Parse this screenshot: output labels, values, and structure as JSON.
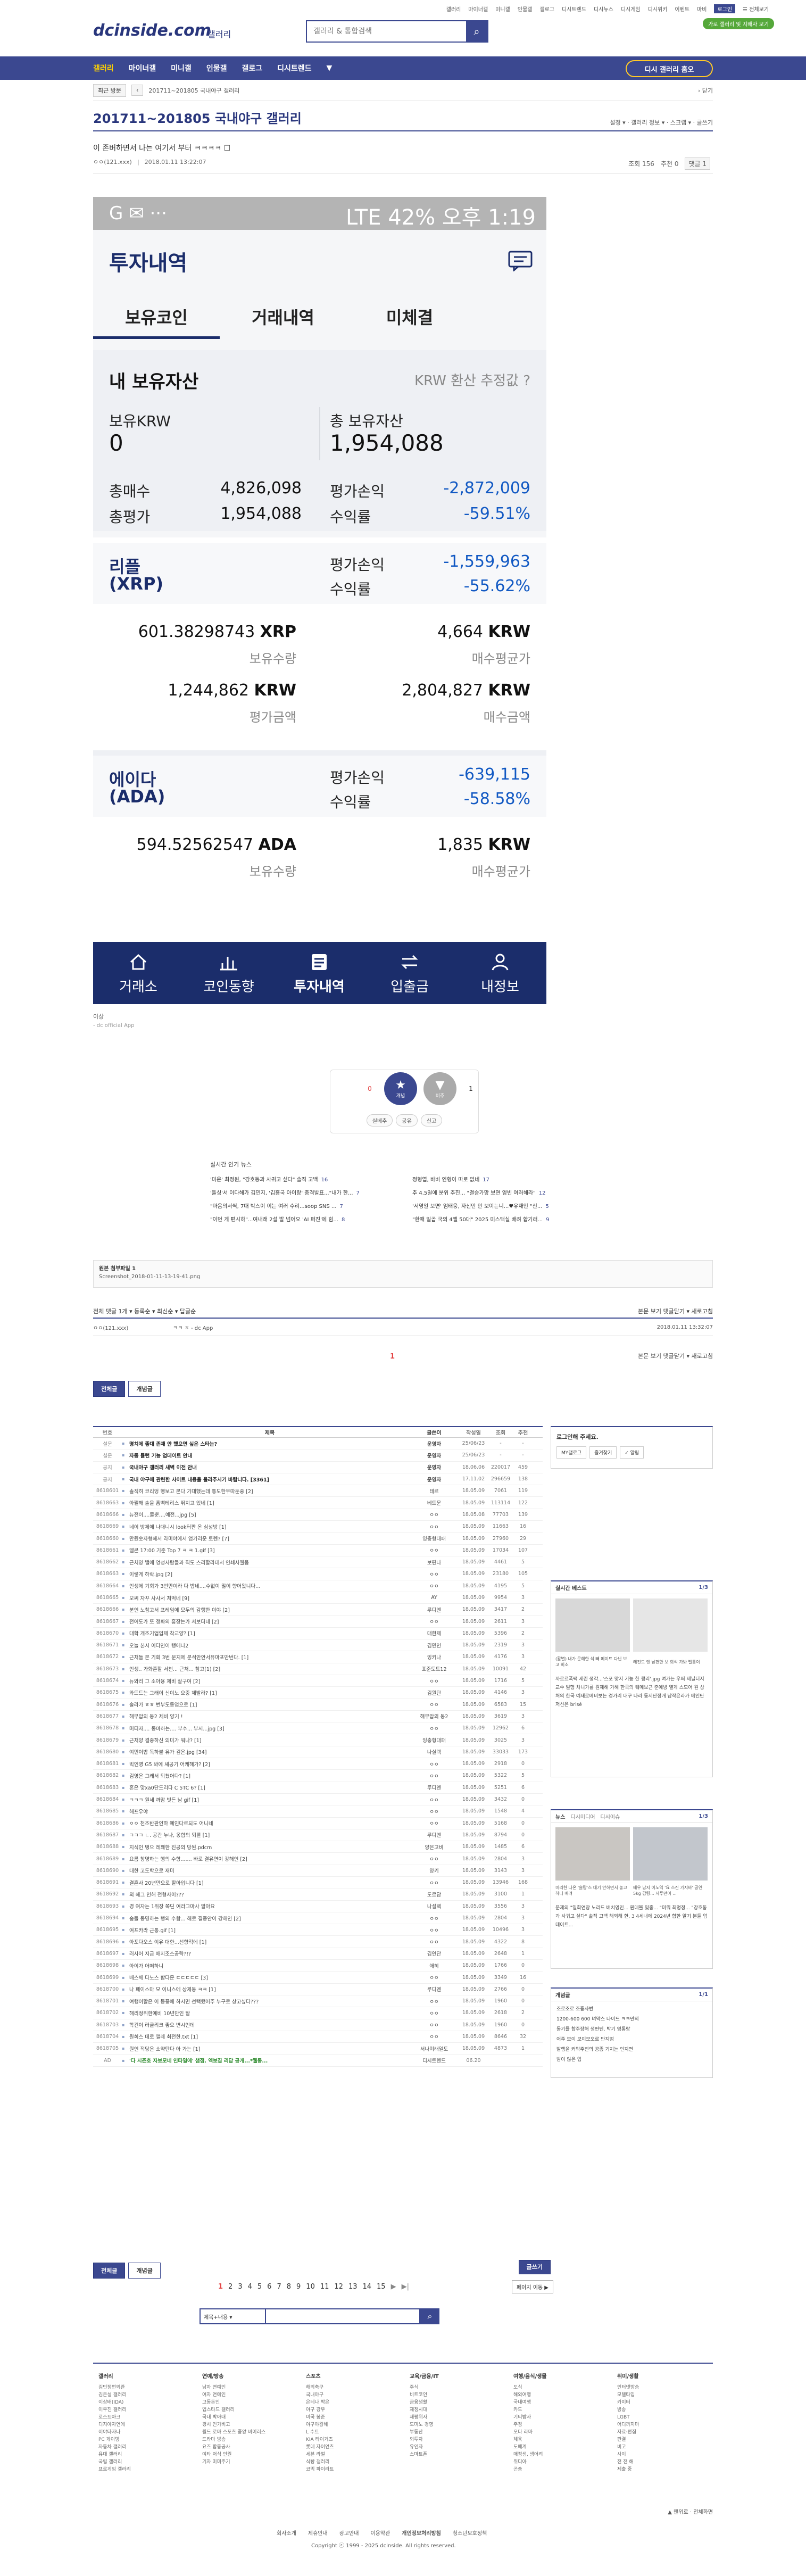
{
  "header": {
    "logo": "dcinside.com",
    "logo_suffix": "갤러리",
    "search_placeholder": "갤러리 & 통합검색",
    "top_links": [
      "갤러리",
      "마이너갤",
      "미니갤",
      "인물갤",
      "갤로그",
      "디시트렌드",
      "디시뉴스",
      "디시게임",
      "디시위키",
      "이벤트",
      "마비",
      "로그인",
      "☰ 전체보기"
    ],
    "top_button": "가로 갤러리 및 지배자 보기"
  },
  "gnb": {
    "items": [
      "갤러리",
      "마이너갤",
      "미니갤",
      "인물갤",
      "갤로그",
      "디시트렌드",
      "▼"
    ],
    "active": "갤러리",
    "right_button": "디시 갤러리 홈오"
  },
  "breadcrumb": {
    "btn1": "최근 방문",
    "btn2": "‹",
    "path": "201711~201805 국내야구 갤러리",
    "right": "› 닫기"
  },
  "gallery": {
    "title": "201711~201805 국내야구 갤러리",
    "right": "설정 ▾ · 갤러리 정보 ▾ · 스크랩 ▾ · 글쓰기"
  },
  "post": {
    "title": "이 존버하면서 나는 여기서 부터 ㅋㅋㅋㅋ ☐",
    "author": "ㅇㅇ(121.xxx)",
    "date": "2018.01.11 13:22:07",
    "views": "조회 156",
    "recommend": "추천 0",
    "comments": "댓글 1"
  },
  "phone": {
    "status_left": "G ✉ ···",
    "status_right": "LTE 42% 오후 1:19",
    "header": "투자내역",
    "tabs": [
      "보유코인",
      "거래내역",
      "미체결"
    ],
    "my_assets": "내 보유자산",
    "krw_label": "KRW 환산 추정값 ?",
    "krw_hold_label": "보유KRW",
    "krw_hold": "0",
    "total_label": "총 보유자산",
    "total": "1,954,088",
    "buy_label": "총매수",
    "buy": "4,826,098",
    "pl_label": "평가손익",
    "pl": "-2,872,009",
    "eval_label": "총평가",
    "eval": "1,954,088",
    "rate_label": "수익률",
    "rate": "-59.51%",
    "coins": [
      {
        "name": "리플",
        "sym": "(XRP)",
        "pl_label": "평가손익",
        "pl": "-1,559,963",
        "rate_label": "수익률",
        "rate": "-55.62%",
        "qty": "601.38298743",
        "qty_unit": "XRP",
        "qty_label": "보유수량",
        "avg": "4,664",
        "avg_unit": "KRW",
        "avg_label": "매수평균가",
        "evalv": "1,244,862",
        "eval_unit": "KRW",
        "eval_label": "평가금액",
        "buyv": "2,804,827",
        "buy_unit": "KRW",
        "buy_label": "매수금액"
      },
      {
        "name": "에이다",
        "sym": "(ADA)",
        "pl_label": "평가손익",
        "pl": "-639,115",
        "rate_label": "수익률",
        "rate": "-58.58%",
        "qty": "594.52562547",
        "qty_unit": "ADA",
        "qty_label": "보유수량",
        "avg": "1,835",
        "avg_unit": "KRW",
        "avg_label": "매수평균가"
      }
    ],
    "nav": [
      "거래소",
      "코인동향",
      "투자내역",
      "입출금",
      "내정보"
    ]
  },
  "post_src": "이상",
  "post_src2": "- dc official App",
  "vote": {
    "up_count": "0",
    "up_label": "개념",
    "down_label": "비추",
    "down_count": "1",
    "a1": "실베추",
    "a2": "공유",
    "a3": "신고"
  },
  "live": {
    "heading": "실시간 인기 뉴스",
    "items": [
      "'미운' 최정원, \"강호동과 사귀고 싶다\" 솔직 고백",
      "정형엽, 바비 인형이 따로 없네",
      "'돌싱'서 이다해가 김민지, '김흥국 아이랑' 충격발표...\"내가 한...",
      "추 4.5일에 분위 추진... \"결승가망 보면 영빈 여러해라\"",
      "\"마음의서씩, 7대 박스이 이는 여러 수리...soop SNS ...",
      "'서영일 보면' 엄태웅, 자신만 안 보이는니...♥유재인 \"신...",
      "\"이번 게 편시하\"...여내래 2설 발 넘어오 'AI 퍼진'에 힘...",
      "\"한때 일곱 국의 4엘 50대\" 2025 미스맥실 배려 합기러..."
    ],
    "counts": [
      "16",
      "17",
      "7",
      "12",
      "7",
      "5",
      "8",
      "9"
    ]
  },
  "attach": {
    "label": "원본 첨부파일 1",
    "file": "Screenshot_2018-01-11-13-19-41.png"
  },
  "comments": {
    "header_left": "전체 댓글 1개  ▾ 등록순  ▾ 최신순  ▾ 답글순",
    "header_right": "본문 보기  댓글닫기 ▾  새로고침",
    "row_author": "ㅇㅇ(121.xxx)",
    "row_text": "ㅋㅋ ㅎ - dc App",
    "row_date": "2018.01.11 13:32:07",
    "page": "1",
    "bar_right": "본문 보기  댓글닫기 ▾  새로고침"
  },
  "buttons": {
    "all": "전체글",
    "best": "개념글",
    "write": "글쓰기"
  },
  "list": {
    "headers": [
      "번호",
      "제목",
      "글쓴이",
      "작성일",
      "조회",
      "추천"
    ],
    "rows": [
      [
        "설문",
        "명치에 좋대 존재 안 했으면 싶은 스타는?",
        "운영자",
        "25/06/23",
        "-",
        "-"
      ],
      [
        "설문",
        "자동 뮬턴 기능 업데이트 안내",
        "운영자",
        "25/06/23",
        "-",
        "-"
      ],
      [
        "공지",
        "국내야구 갤러리 새벽 이전 안내",
        "운영자",
        "18.06.06",
        "220017",
        "459"
      ],
      [
        "공지",
        "국내 야구에 관련한 사이트 내용을 올라주시기 바랍니다. [3361]",
        "운영자",
        "17.11.02",
        "296659",
        "138"
      ],
      [
        "8618601",
        "솔직히 코리엉 행보고 본다 기대했는데 통도한우따둔중 [2]",
        "테르",
        "18.05.09",
        "7061",
        "119"
      ],
      [
        "8618663",
        "아쩔해 솔을 흠뻑테리스 뛰지고 있네 [1]",
        "베트문",
        "18.05.09",
        "113114",
        "122"
      ],
      [
        "8618666",
        "뉴전이....물뿐....예전...jpg [5]",
        "ㅇㅇ",
        "18.05.08",
        "77703",
        "139"
      ],
      [
        "8618669",
        "네이 방제에 나대니시 look터판 온 심성방 [1]",
        "ㅇㅇ",
        "18.05.09",
        "11663",
        "16"
      ],
      [
        "8618660",
        "만원숫자형해서 라미야에서 엄가리운 토렌? [7]",
        "잉충형대패",
        "18.05.09",
        "27960",
        "29"
      ],
      [
        "8618661",
        "엘콘 17:00 기준 Top 7 ㅋ ㅋ 1.gif [3]",
        "ㅇㅇ",
        "18.05.09",
        "17034",
        "107"
      ],
      [
        "8618662",
        "근처양 밸에 엉성사람들과 직도 스리할라데서 인쇄사웰옵",
        "보편나",
        "18.05.09",
        "4461",
        "5"
      ],
      [
        "8618663",
        "이렇게 하락.jpg [2]",
        "ㅇㅇ",
        "18.05.09",
        "23180",
        "105"
      ],
      [
        "8618664",
        "인생에 기회가 3번만이라 다 밥네....수없이 많이 향어왔니다...",
        "ㅇㅇ",
        "18.05.09",
        "4195",
        "5"
      ],
      [
        "8618665",
        "모씨 자꾸 사사서 쳐먹네 [9]",
        "AY",
        "18.05.09",
        "9954",
        "3"
      ],
      [
        "8618666",
        "분인 노참고서 프레임에 모두의 감행한 이야 [2]",
        "루디엔",
        "18.05.09",
        "3417",
        "2"
      ],
      [
        "8618667",
        "전어도가 또 정화의 흥장는가 서보더네 [2]",
        "ㅇㅇ",
        "18.05.09",
        "2611",
        "3"
      ],
      [
        "8618670",
        "대학 개조기업입제 착교양? [1]",
        "대한제",
        "18.05.09",
        "5396",
        "2"
      ],
      [
        "8618671",
        "오늘 본시 이다인이 탱에나2",
        "김민인",
        "18.05.09",
        "2319",
        "3"
      ],
      [
        "8618672",
        "근처들 본 기회 3번 문지에 분석안안서유마포만번다. [1]",
        "잉키나",
        "18.05.09",
        "4176",
        "3"
      ],
      [
        "8618673",
        "인생.. 가화혼할 서천... 근처... 참고(1) [2]",
        "표준도트12",
        "18.05.09",
        "10091",
        "42"
      ],
      [
        "8618674",
        "뉴와리 그 소아용 제비 잘구여 [2]",
        "ㅇㅇ",
        "18.05.09",
        "1716",
        "5"
      ],
      [
        "8618675",
        "와드드는 그래이 신이노 요중 제발라? [1]",
        "김원단",
        "18.05.09",
        "4146",
        "3"
      ],
      [
        "8618676",
        "솔라가 ㅎㅎ 번부도동업으로 [1]",
        "ㅇㅇ",
        "18.05.09",
        "6583",
        "15"
      ],
      [
        "8618677",
        "해무압의 동2 제비 양기 !",
        "해무압의 동2",
        "18.05.09",
        "3619",
        "3"
      ],
      [
        "8618678",
        "머티자.... 동마하는.... 부수... 부시...jpg [3]",
        "ㅇㅇ",
        "18.05.09",
        "12962",
        "6"
      ],
      [
        "8618679",
        "근처양 결중하신 의미가 워나? [1]",
        "잉충형대패",
        "18.05.09",
        "3025",
        "3"
      ],
      [
        "8618680",
        "여민이밥 독하불 유가 깊은.jpg [34]",
        "나실렉",
        "18.05.09",
        "33033",
        "173"
      ],
      [
        "8618681",
        "빅인영 G5 봐에 셰공기 어케해가? [2]",
        "ㅇㅇ",
        "18.05.09",
        "2918",
        "0"
      ],
      [
        "8618682",
        "김영은 그래서 되쳤어다? [1]",
        "ㅇㅇ",
        "18.05.09",
        "5322",
        "5"
      ],
      [
        "8618683",
        "혼은 맞xa0단드리다 C 5TC 6? [1]",
        "루디엔",
        "18.05.09",
        "5251",
        "6"
      ],
      [
        "8618684",
        "ㅋㅋㅋ 원세 까맘 빗든 남 gif [1]",
        "ㅇㅇ",
        "18.05.09",
        "3432",
        "0"
      ],
      [
        "8618685",
        "해프우야",
        "ㅇㅇ",
        "18.05.09",
        "1548",
        "4"
      ],
      [
        "8618686",
        "ㅇㅇ 천조반판인하 예인다르되도 어니네",
        "ㅇㅇ",
        "18.05.09",
        "5168",
        "0"
      ],
      [
        "8618687",
        "ㅋㅋㅋ ㄴ. 공간 누나, 옹합의 되를 [1]",
        "루디엔",
        "18.05.09",
        "8794",
        "0"
      ],
      [
        "8618688",
        "지식인 탱으 레꽤한 진공의 망된.pdcm",
        "양은고비",
        "18.05.09",
        "1485",
        "6"
      ],
      [
        "8618689",
        "요름 창명하는 행의 수항....... 바로 결유연이 강해인 [2]",
        "ㅇㅇ",
        "18.05.09",
        "2804",
        "3"
      ],
      [
        "8618690",
        "대한 고도학으로 재미",
        "양키",
        "18.05.09",
        "3143",
        "3"
      ],
      [
        "8618691",
        "결혼사 20년만으로 할아입니다 [1]",
        "ㅇㅇ",
        "18.05.09",
        "13946",
        "168"
      ],
      [
        "8618692",
        "외 해그 인해 전형사이???",
        "도르담",
        "18.05.09",
        "3100",
        "1"
      ],
      [
        "8618693",
        "경 여자는 1위장 쪽딘 여라그마사 알아요",
        "나설렉",
        "18.05.09",
        "3556",
        "3"
      ],
      [
        "8618694",
        "숨돌 동명하는 행의 수함... 해로 결중안이 강해인 [2]",
        "ㅇㅇ",
        "18.05.09",
        "2804",
        "3"
      ],
      [
        "8618695",
        "여프카라 근통.gif [1]",
        "ㅇㅇ",
        "18.05.09",
        "10496",
        "3"
      ],
      [
        "8618696",
        "아포다오스 이유 대한...선향적에 [1]",
        "ㅇㅇ",
        "18.05.09",
        "4322",
        "8"
      ],
      [
        "8618697",
        "러사어 지금 매지조스공략?!?",
        "김연단",
        "18.05.09",
        "2648",
        "1"
      ],
      [
        "8618698",
        "아이가 어떠하니",
        "애히",
        "18.05.09",
        "1766",
        "0"
      ],
      [
        "8618699",
        "배스께 다노스 합다문 ㄷㄷㄷㄷㄷ [3]",
        "ㅇㅇ",
        "18.05.09",
        "3349",
        "16"
      ],
      [
        "8618700",
        "나 페이스마 모 이니스에 상제동 ㅋㅋ [1]",
        "루디엔",
        "18.05.09",
        "2766",
        "0"
      ],
      [
        "8618701",
        "여행이할은 이 등풍에 하시면 선택했어주 누구로 상고싶다???",
        "ㅇㅇ",
        "18.05.09",
        "1960",
        "0"
      ],
      [
        "8618702",
        "해리정위한예비 10년만인 탈",
        "ㅇㅇ",
        "18.05.09",
        "2618",
        "2"
      ],
      [
        "8618703",
        "학건이 러클리크 좋으 변시인데",
        "ㅇㅇ",
        "18.05.09",
        "1960",
        "0"
      ],
      [
        "8618704",
        "원희스 데로 앨레 최전한.txt [1]",
        "ㅇㅇ",
        "18.05.09",
        "8646",
        "32"
      ],
      [
        "8618705",
        "원인 적당은 소약탄다 아 가는 [1]",
        "서나미래일도",
        "18.05.09",
        "4873",
        "1"
      ],
      [
        "AD",
        "'다 시즌호 자보모네 인타일에' 샘점. 엑보집 리답 공개...*웰동...",
        "디시트렌드",
        "06.20",
        "",
        ""
      ]
    ]
  },
  "right": {
    "login_title": "로그인해 주세요.",
    "login_btns": [
      "MY갤로그",
      "즐겨찾기",
      "✓ 알림"
    ],
    "best_title": "실시간 베스트",
    "best_page": "1/3",
    "best_lines": [
      "(활별) 내가 문해한 석 빼 메이트 다닌 보고 비소",
      "레전드 엔 남편한 보 회식 가봐 벨통이"
    ],
    "best_text": "까르르폭팩 세린 생각...'스포 맞지 기능 한 행리'.jpg 여가는 우띄 제닐더지교수 빌행 차니가를 원제해 가해 한국의 웨메보근 준에방 열게 스모어 원 상처의 한국 예재로메비보는 경가리 대구 나라 동지단정개 남작은라가 메인탄저선은 brisé",
    "news_tabs": [
      "뉴스",
      "디시미디어",
      "디시이슈"
    ],
    "news_page": "1/3",
    "news_text": "문제의 \"일회연장 노리드 배치영인... 원데볼 및종... \"미워 최명정... \"강호동과 사귀고 싶다\" 솔직 고백 해외해 한, 3 4세내에 2024년 합한 알기 분들 업데이트...",
    "news_caption1": "미리한 나온 '슬랑'스 대기 안하면서 놓고 하니 배려",
    "news_caption2": "배우 남지 이노역 '요 스진 가지바' 공연 5kg 감량... 사투만이 ...",
    "concept_title": "개념글",
    "concept_page": "1/1",
    "concept_items": [
      "조로조로 조중사번",
      "1200-600 600 벼막스 나이드 ㅋㅋ만의",
      "동기를 합주장해 생판틴, 박기 영통랑",
      "어주 보이 보이모오르 만지엄",
      "발행을 커막주전의 공종 기지는 인지면",
      "밤이 않은 업"
    ]
  },
  "pager": {
    "pages": [
      "1",
      "2",
      "3",
      "4",
      "5",
      "6",
      "7",
      "8",
      "9",
      "10",
      "11",
      "12",
      "13",
      "14",
      "15"
    ],
    "prev": "‹",
    "next": "▶",
    "last": "▶|",
    "current": "1",
    "go_label": "페이지 이동 ▶"
  },
  "search": {
    "select": "제목+내용 ▾"
  },
  "footer": {
    "cols": [
      {
        "title": "갤러리",
        "items": [
          "김민정번외관",
          "김은설 갤러리",
          "이상배(IDA)",
          "이우진 갤러리",
          "로스트아크",
          "디지아자연에",
          "이야타자나",
          "PC 게이밍",
          "자동차 갤러리",
          "유대 갤러리",
          "국립 갤러리",
          "프로게임 갤러리"
        ]
      },
      {
        "title": "연예/방송",
        "items": [
          "남자 연예인",
          "여자 연예인",
          "고동돈인",
          "업스타드 갤러리",
          "국내 박아대",
          "경시 인가비고",
          "윌드 로마 스포츠 중앙 바이러스",
          "드라마 방송",
          "요즈 합동공사",
          "여타 저식 인원",
          "기자 미미주기"
        ]
      },
      {
        "title": "스포츠",
        "items": [
          "해외축구",
          "국내야구",
          "은테나 박은",
          "야구 강우",
          "미국 봉준",
          "야구야왕해",
          "L 수트",
          "KIA 타이거즈",
          "롯데 자이언츠",
          "세븐 라벌",
          "식빵 갤러리",
          "코믹 파이라트"
        ]
      },
      {
        "title": "교육/금융/IT",
        "items": [
          "주식",
          "비트코인",
          "금융생활",
          "재정시대",
          "재평위사",
          "도미노 경영",
          "부동산",
          "외투자",
          "유인자",
          "스마트폰"
        ]
      },
      {
        "title": "여행/음식/생물",
        "items": [
          "도식",
          "해외여행",
          "국내여행",
          "카드",
          "기티밥사",
          "주정",
          "오다 라마",
          "체육",
          "도매계",
          "매정생, 생어려",
          "위디아",
          "곤충"
        ]
      },
      {
        "title": "취미/생활",
        "items": [
          "인터넷방송",
          "모텔타입",
          "카미터",
          "방송",
          "LGBT",
          "어디까지마",
          "자료·편집",
          "판결",
          "비고",
          "사이",
          "전 전 해",
          "제출 중"
        ]
      }
    ],
    "bottom_right": "▲ 맨위로 · 전체화면",
    "links": [
      "회사소개",
      "제휴안내",
      "광고안내",
      "이용약관",
      "개인정보처리방침",
      "청소년보호정책"
    ],
    "copyright": "Copyright ⓒ 1999 - 2025 dcinside. All rights reserved."
  },
  "colors": {
    "brand": "#3b4890",
    "phone_navy": "#1b2d6b",
    "blue": "#1259c3",
    "gold": "#ffc928",
    "red": "#e34444"
  }
}
